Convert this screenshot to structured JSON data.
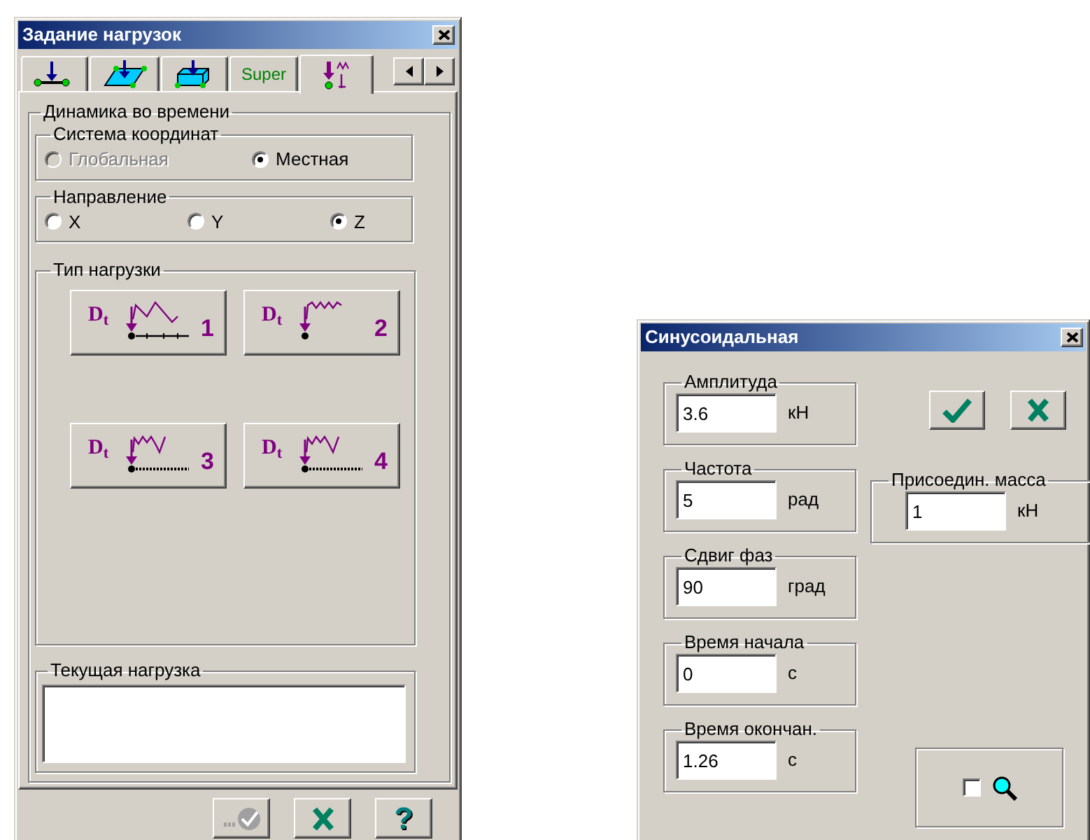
{
  "load_dialog": {
    "title": "Задание нагрузок",
    "tabs": [
      {
        "kind": "icon",
        "selected": false
      },
      {
        "kind": "icon",
        "selected": false
      },
      {
        "kind": "icon",
        "selected": false
      },
      {
        "kind": "text",
        "label": "Super",
        "selected": false
      },
      {
        "kind": "icon",
        "selected": true
      }
    ],
    "section": {
      "label": "Динамика во времени",
      "coordinate_system": {
        "label": "Система координат",
        "options": [
          {
            "label": "Глобальная",
            "selected": false,
            "disabled": true
          },
          {
            "label": "Местная",
            "selected": true,
            "disabled": false
          }
        ]
      },
      "direction": {
        "label": "Направление",
        "options": [
          {
            "label": "X",
            "selected": false,
            "disabled": false
          },
          {
            "label": "Y",
            "selected": false,
            "disabled": false
          },
          {
            "label": "Z",
            "selected": true,
            "disabled": false
          }
        ]
      },
      "load_type": {
        "label": "Тип нагрузки",
        "buttons": [
          {
            "symbol": "D$_{t}$",
            "number": "1"
          },
          {
            "symbol": "D$_{t}$",
            "number": "2"
          },
          {
            "symbol": "D$_{t}$",
            "number": "3"
          },
          {
            "symbol": "D$_{t}$",
            "number": "4"
          }
        ]
      },
      "current_load": {
        "label": "Текущая нагрузка"
      }
    },
    "footer": [
      {
        "kind": "apply",
        "disabled": true
      },
      {
        "kind": "cancel",
        "disabled": false
      },
      {
        "kind": "help",
        "label": "?",
        "disabled": false
      }
    ]
  },
  "sine_dialog": {
    "title": "Синусоидальная",
    "fields": [
      {
        "label": "Амплитуда",
        "value": "3.6",
        "unit": "кН"
      },
      {
        "label": "Частота",
        "value": "5",
        "unit": "рад"
      },
      {
        "label": "Сдвиг фаз",
        "value": "90",
        "unit": "град"
      },
      {
        "label": "Время начала",
        "value": "0",
        "unit": "с"
      },
      {
        "label": "Время окончан.",
        "value": "1.26",
        "unit": "с"
      }
    ],
    "attached_mass": {
      "label": "Присоедин. масса",
      "value": "1",
      "unit": "кН"
    },
    "buttons": [
      {
        "kind": "ok"
      },
      {
        "kind": "cancel"
      }
    ],
    "preview": {
      "checked": false
    }
  }
}
